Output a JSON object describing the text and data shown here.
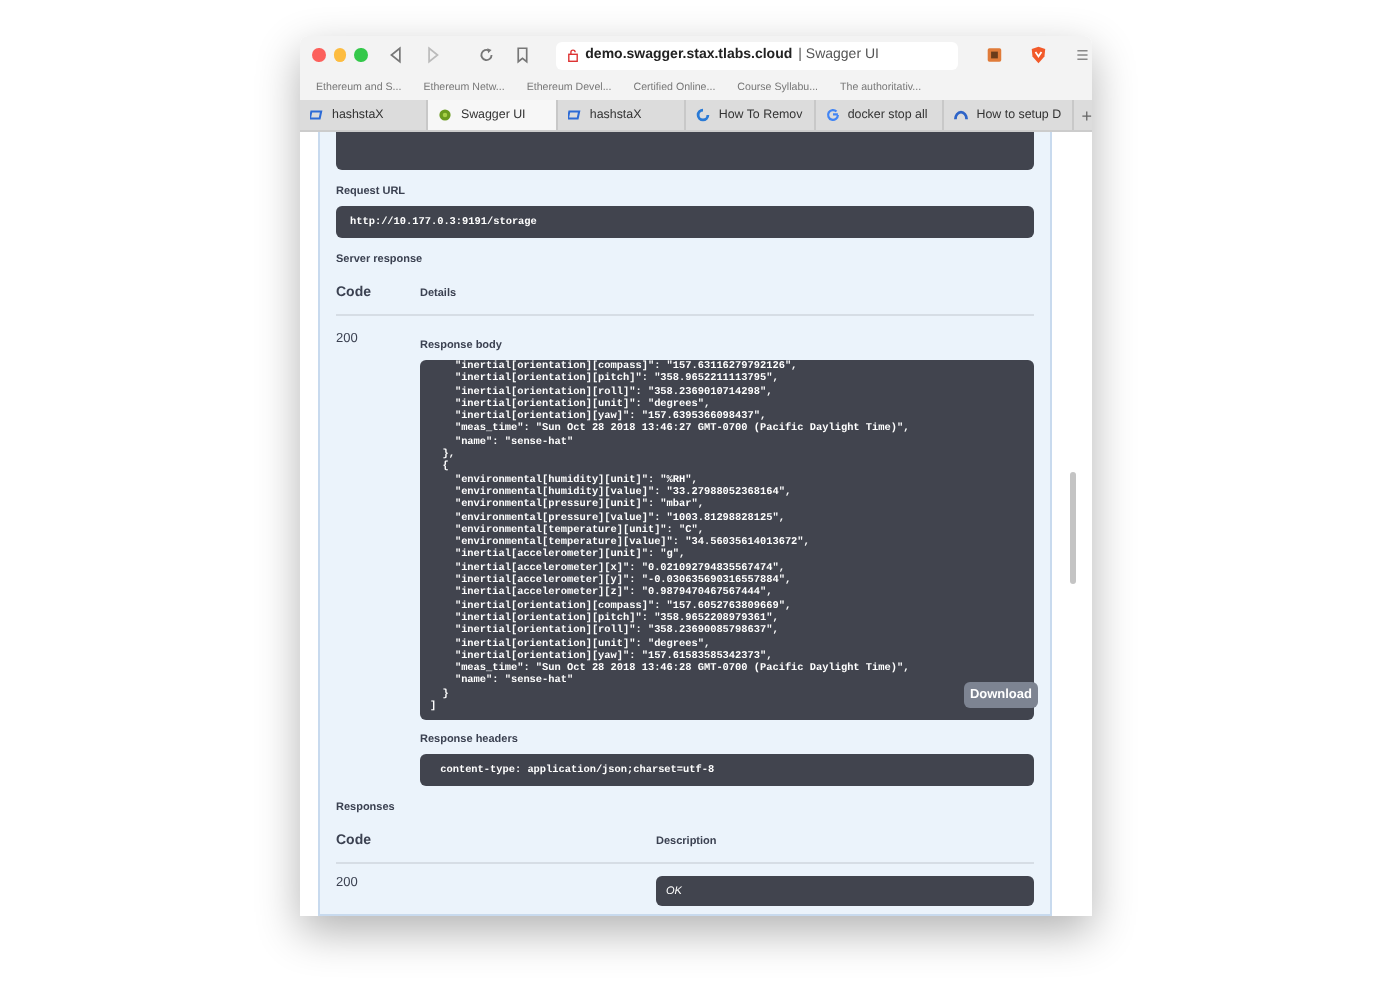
{
  "address_bar": {
    "host": "demo.swagger.stax.tlabs.cloud",
    "title": "| Swagger UI"
  },
  "bookmarks": [
    "Ethereum and S...",
    "Ethereum Netw...",
    "Ethereum Devel...",
    "Certified Online...",
    "Course Syllabu...",
    "The authoritativ..."
  ],
  "tabs": [
    {
      "label": "hashstaX",
      "selected": false,
      "kind": "square"
    },
    {
      "label": "Swagger UI",
      "selected": true,
      "kind": "swagger"
    },
    {
      "label": "hashstaX",
      "selected": false,
      "kind": "square"
    },
    {
      "label": "How To Remov",
      "selected": false,
      "kind": "ring"
    },
    {
      "label": "docker stop all",
      "selected": false,
      "kind": "google"
    },
    {
      "label": "How to setup D",
      "selected": false,
      "kind": "arch"
    }
  ],
  "new_tab": "+",
  "request_url": {
    "label": "Request URL",
    "value": "http://10.177.0.3:9191/storage"
  },
  "server_response": {
    "label": "Server response",
    "columns": [
      "Code",
      "Details"
    ],
    "code": "200",
    "body_label": "Response body",
    "body_lines": [
      "    \"inertial[orientation][compass]\": \"157.63116279792126\",",
      "    \"inertial[orientation][pitch]\": \"358.9652211113795\",",
      "    \"inertial[orientation][roll]\": \"358.2369010714298\",",
      "    \"inertial[orientation][unit]\": \"degrees\",",
      "    \"inertial[orientation][yaw]\": \"157.6395366098437\",",
      "    \"meas_time\": \"Sun Oct 28 2018 13:46:27 GMT-0700 (Pacific Daylight Time)\",",
      "    \"name\": \"sense-hat\"",
      "  },",
      "  {",
      "    \"environmental[humidity][unit]\": \"%RH\",",
      "    \"environmental[humidity][value]\": \"33.27988052368164\",",
      "    \"environmental[pressure][unit]\": \"mbar\",",
      "    \"environmental[pressure][value]\": \"1003.81298828125\",",
      "    \"environmental[temperature][unit]\": \"C\",",
      "    \"environmental[temperature][value]\": \"34.56035614013672\",",
      "    \"inertial[accelerometer][unit]\": \"g\",",
      "    \"inertial[accelerometer][x]\": \"0.021092794835567474\",",
      "    \"inertial[accelerometer][y]\": \"-0.030635690316557884\",",
      "    \"inertial[accelerometer][z]\": \"0.9879470467567444\",",
      "    \"inertial[orientation][compass]\": \"157.6052763809669\",",
      "    \"inertial[orientation][pitch]\": \"358.9652208979361\",",
      "    \"inertial[orientation][roll]\": \"358.23690085798637\",",
      "    \"inertial[orientation][unit]\": \"degrees\",",
      "    \"inertial[orientation][yaw]\": \"157.61583585342373\",",
      "    \"meas_time\": \"Sun Oct 28 2018 13:46:28 GMT-0700 (Pacific Daylight Time)\",",
      "    \"name\": \"sense-hat\"",
      "  }",
      "]"
    ],
    "download": "Download",
    "headers_label": "Response headers",
    "headers": " content-type: application/json;charset=utf-8 "
  },
  "responses": {
    "label": "Responses",
    "columns": [
      "Code",
      "Description"
    ],
    "rows": [
      {
        "code": "200",
        "description": "OK"
      }
    ]
  }
}
